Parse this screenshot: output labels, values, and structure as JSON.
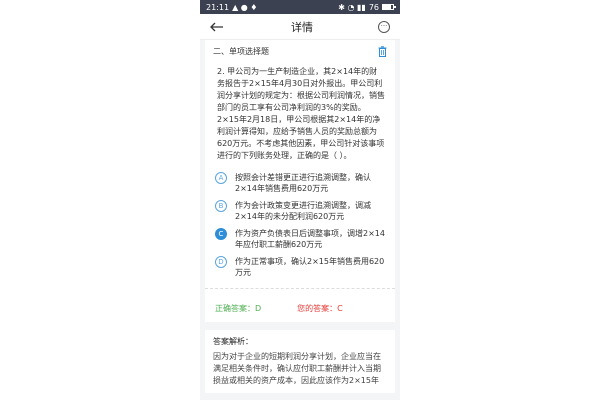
{
  "status_bar": {
    "time": "21:11",
    "battery": "76"
  },
  "nav": {
    "title": "详情"
  },
  "section": {
    "title": "二、单项选择题"
  },
  "question": {
    "text": "2. 甲公司为一生产制造企业，其2×14年的财务报告于2×15年4月30日对外报出。甲公司利润分享计划的规定为：根据公司利润情况，销售部门的员工享有公司净利润的3%的奖励。2×15年2月18日，甲公司根据其2×14年的净利润计算得知，应给予销售人员的奖励总额为620万元。不考虑其他因素，甲公司针对该事项进行的下列账务处理，正确的是（ ）。"
  },
  "options": [
    {
      "letter": "A",
      "text": "按照会计差错更正进行追溯调整，确认2×14年销售费用620万元"
    },
    {
      "letter": "B",
      "text": "作为会计政策变更进行追溯调整，调减2×14年的未分配利润620万元"
    },
    {
      "letter": "C",
      "text": "作为资产负债表日后调整事项，调增2×14年应付职工薪酬620万元"
    },
    {
      "letter": "D",
      "text": "作为正常事项，确认2×15年销售费用620万元"
    }
  ],
  "selected_option": "C",
  "answer": {
    "correct_label": "正确答案：D",
    "yours_label": "您的答案：C"
  },
  "analysis": {
    "title": "答案解析：",
    "text": "因为对于企业的短期利润分享计划，企业应当在满足相关条件时，确认应付职工薪酬并计入当期损益或相关的资产成本，因此应该作为2×15年"
  },
  "colors": {
    "accent": "#2e8fd8",
    "correct": "#4caf50",
    "wrong": "#e53935",
    "status_bar": "#3b4151"
  }
}
